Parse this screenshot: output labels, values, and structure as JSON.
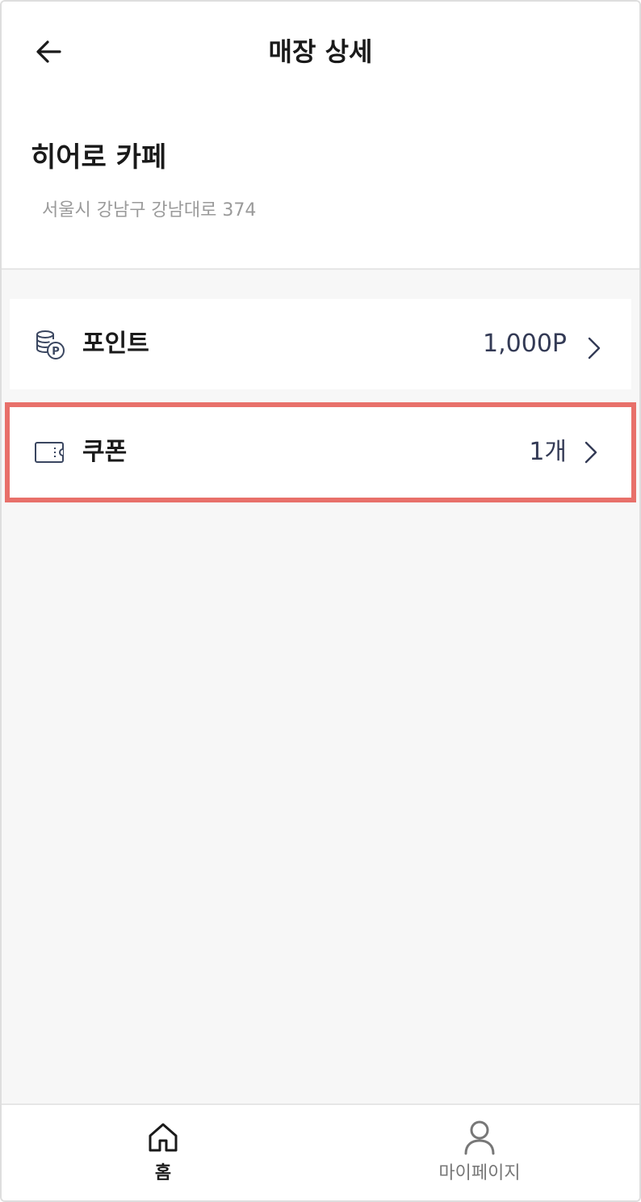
{
  "header": {
    "title": "매장 상세",
    "back_icon": "arrow-left-icon"
  },
  "store": {
    "name": "히어로 카페",
    "address": "서울시 강남구 강남대로 374"
  },
  "menu": {
    "points": {
      "label": "포인트",
      "value": "1,000P",
      "icon": "points-coins-icon"
    },
    "coupon": {
      "label": "쿠폰",
      "value": "1개",
      "icon": "coupon-ticket-icon",
      "highlight_color": "#e8706a"
    }
  },
  "bottom_nav": {
    "items": [
      {
        "label": "홈",
        "icon": "home-icon",
        "active": true
      },
      {
        "label": "마이페이지",
        "icon": "user-icon",
        "active": false
      }
    ]
  },
  "colors": {
    "background": "#f7f7f7",
    "value_text": "#333a55",
    "highlight": "#e8706a"
  }
}
